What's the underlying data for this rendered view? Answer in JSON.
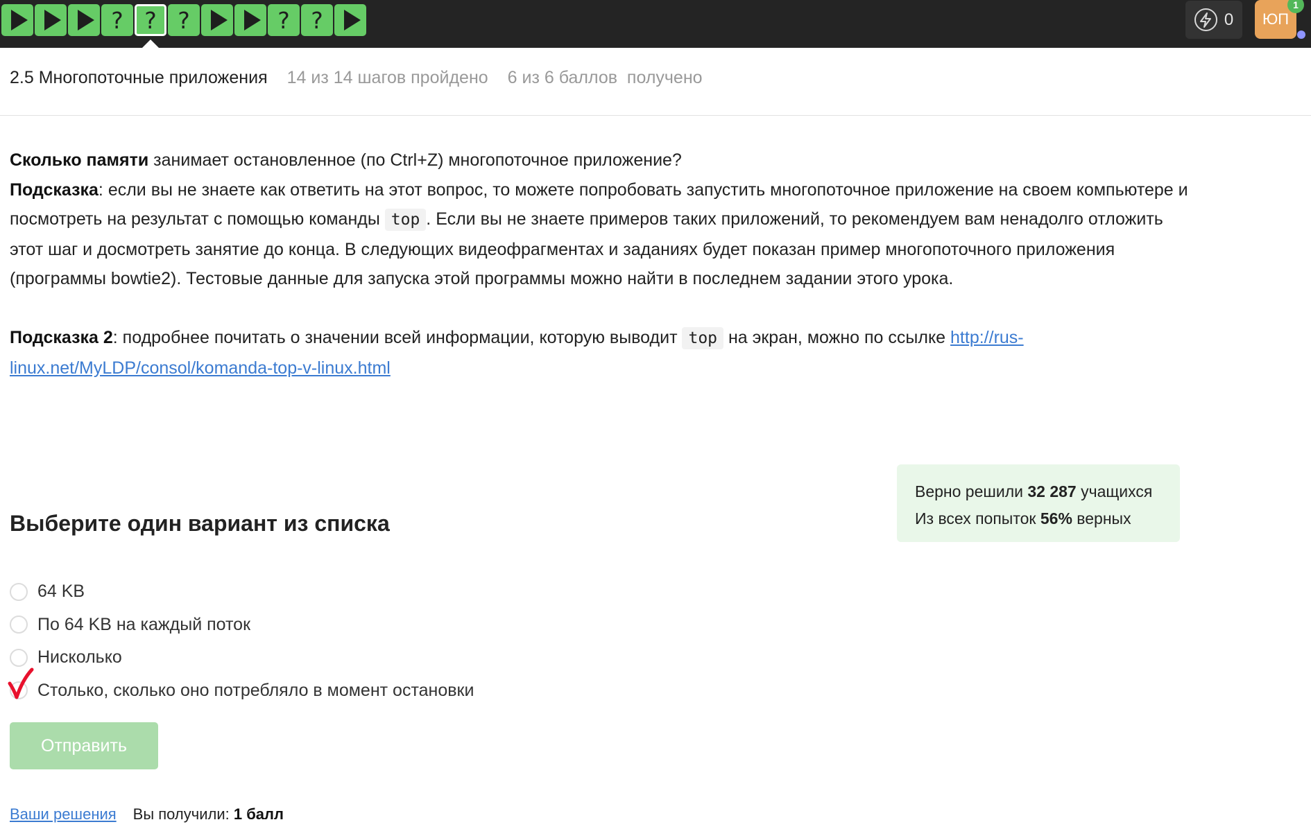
{
  "topbar": {
    "steps": [
      {
        "kind": "play"
      },
      {
        "kind": "play"
      },
      {
        "kind": "play"
      },
      {
        "kind": "quiz",
        "glyph": "?"
      },
      {
        "kind": "quiz",
        "glyph": "?",
        "active": true
      },
      {
        "kind": "quiz",
        "glyph": "?"
      },
      {
        "kind": "play"
      },
      {
        "kind": "play"
      },
      {
        "kind": "quiz",
        "glyph": "?"
      },
      {
        "kind": "quiz",
        "glyph": "?"
      },
      {
        "kind": "play"
      }
    ],
    "energy_count": "0",
    "avatar_initials": "ЮП",
    "notification_count": "1",
    "colors": {
      "bar": "#242424",
      "step_green": "#66cc66",
      "avatar": "#e8a35a",
      "notif": "#53b85a",
      "dot": "#8f95ff"
    }
  },
  "lesson": {
    "title": "2.5 Многопоточные приложения",
    "steps_progress": "14 из 14 шагов пройдено",
    "score_progress": "6 из 6 баллов  получено"
  },
  "question": {
    "q_bold": "Сколько памяти",
    "q_rest": " занимает остановленное (по Ctrl+Z) многопоточное приложение?",
    "hint1_label": "Подсказка",
    "hint1_part1": ": если вы не знаете как ответить на этот вопрос, то можете попробовать запустить многопоточное приложение на своем компьютере и посмотреть на результат с помощью команды ",
    "hint1_code": "top",
    "hint1_part2": ". Если вы не знаете примеров таких приложений, то рекомендуем вам ненадолго отложить этот шаг и досмотреть занятие до конца. В следующих видеофрагментах и заданиях будет показан пример многопоточного приложения (программы bowtie2). Тестовые данные для запуска этой программы можно найти в последнем задании этого урока.",
    "hint2_label": "Подсказка 2",
    "hint2_part1": ": подробнее почитать о значении всей информации, которую выводит ",
    "hint2_code": "top",
    "hint2_part2": " на экран, можно по ссылке ",
    "hint2_link": "http://rus-linux.net/MyLDP/consol/komanda-top-v-linux.html"
  },
  "stats": {
    "solved_prefix": "Верно решили ",
    "solved_count": "32 287",
    "solved_suffix": " учащихся",
    "attempts_prefix": "Из всех попыток ",
    "attempts_percent": "56%",
    "attempts_suffix": " верных",
    "bg_color": "#e9f7e9"
  },
  "quiz": {
    "title": "Выберите один вариант из списка",
    "options": [
      "64 KB",
      "По 64 KB на каждый поток",
      "Нисколько",
      "Столько, сколько оно потребляло в момент остановки"
    ],
    "marked_option_index": 3,
    "mark_color": "#e8112d",
    "submit_label": "Отправить"
  },
  "footer": {
    "solutions_link": "Ваши решения",
    "received_prefix": "Вы получили: ",
    "received_value": "1 балл"
  }
}
